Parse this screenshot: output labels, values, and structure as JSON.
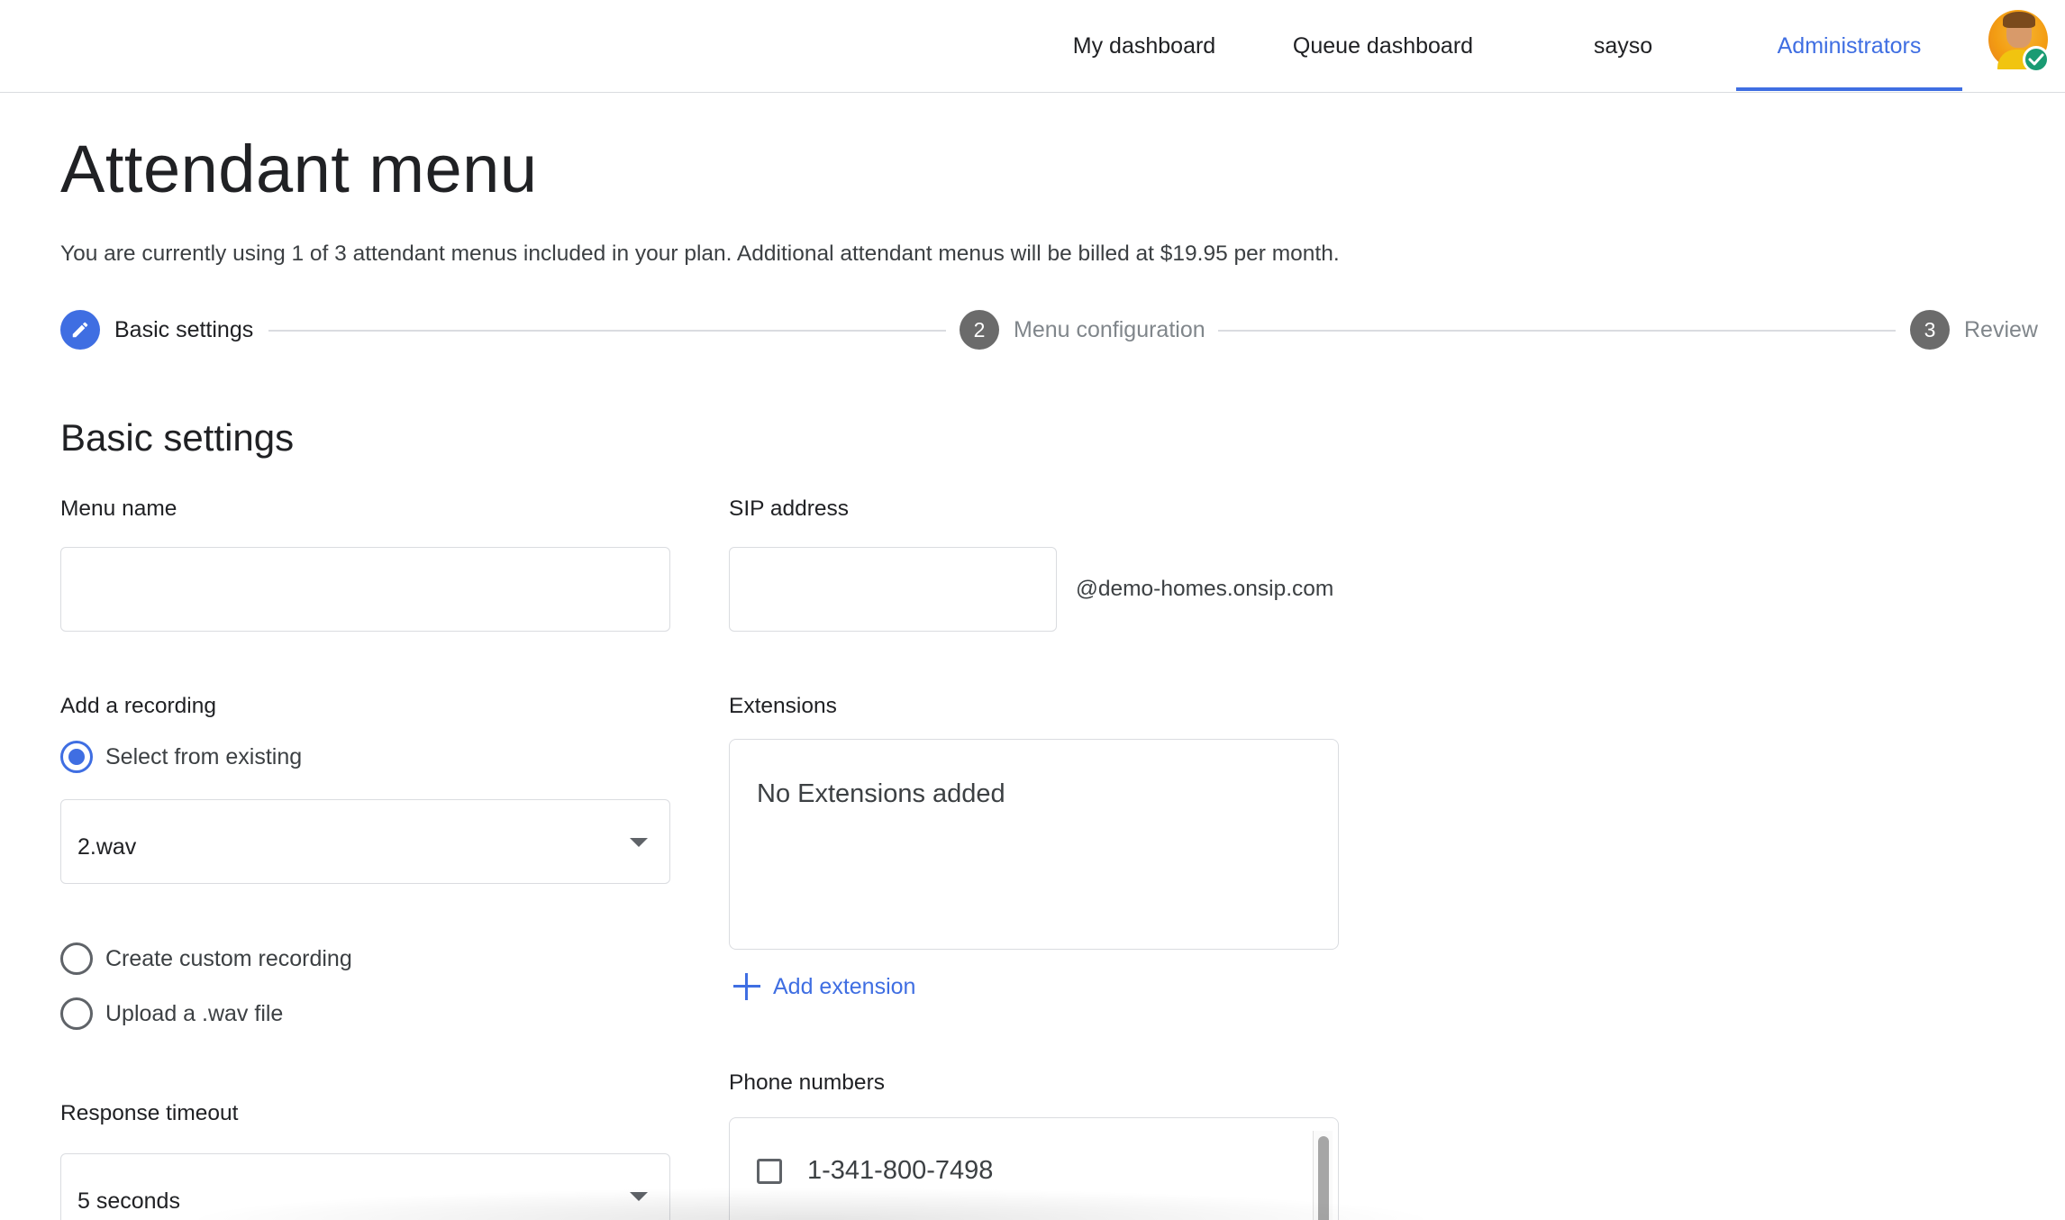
{
  "nav": {
    "items": [
      {
        "label": "My dashboard"
      },
      {
        "label": "Queue dashboard"
      },
      {
        "label": "sayso"
      },
      {
        "label": "Administrators"
      }
    ],
    "active_color": "#3f6ee2"
  },
  "page": {
    "title": "Attendant menu",
    "plan_note": "You are currently using 1 of 3 attendant menus included in your plan. Additional attendant menus will be billed at $19.95 per month."
  },
  "stepper": {
    "steps": [
      {
        "number": "",
        "label": "Basic settings",
        "icon": "pencil-icon",
        "state": "active"
      },
      {
        "number": "2",
        "label": "Menu configuration",
        "state": "inactive"
      },
      {
        "number": "3",
        "label": "Review",
        "state": "inactive"
      }
    ]
  },
  "basic_settings": {
    "section_title": "Basic settings",
    "menu_name": {
      "label": "Menu name",
      "value": ""
    },
    "sip_address": {
      "label": "SIP address",
      "value": "",
      "domain_suffix": "@demo-homes.onsip.com"
    },
    "recording": {
      "label": "Add a recording",
      "options": [
        {
          "label": "Select from existing",
          "checked": true
        },
        {
          "label": "Create custom recording",
          "checked": false
        },
        {
          "label": "Upload a .wav file",
          "checked": false
        }
      ],
      "selected_file": "2.wav"
    },
    "extensions": {
      "label": "Extensions",
      "empty_text": "No Extensions added",
      "add_label": "Add extension"
    },
    "response_timeout": {
      "label": "Response timeout",
      "value": "5 seconds"
    },
    "phone_numbers": {
      "label": "Phone numbers",
      "items": [
        {
          "number": "1-341-800-7498",
          "checked": false
        }
      ]
    }
  }
}
